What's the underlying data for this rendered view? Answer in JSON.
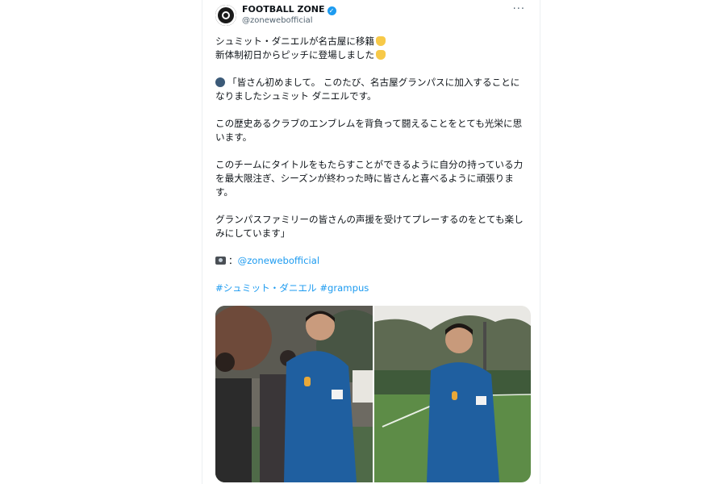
{
  "tweet": {
    "author_name": "FOOTBALL ZONE",
    "author_handle": "@zonewebofficial",
    "more_label": "···",
    "lines": {
      "l1": "シュミット・ダニエルが名古屋に移籍",
      "l2": "新体制初日からピッチに登場しました",
      "l3": "「皆さん初めまして。 このたび、名古屋グランパスに加入することに",
      "l4": "なりましたシュミット ダニエルです。",
      "l5": "この歴史あるクラブのエンブレムを背負って闘えることをとても光栄に思",
      "l6": "います。",
      "l7": "このチームにタイトルをもたらすことができるように自分の持っている力",
      "l8": "を最大限注ぎ、シーズンが終わった時に皆さんと喜べるように頑張りま",
      "l9": "す。",
      "l10": "グランパスファミリーの皆さんの声援を受けてプレーするのをとても楽し",
      "l11": "みにしています」",
      "credit_prefix": "：",
      "credit_handle": "@zonewebofficial",
      "hashtag1": "#シュミット・ダニエル",
      "hashtag2": "#grampus"
    },
    "colors": {
      "link": "#1d9bf0",
      "text": "#0f1419",
      "muted": "#536471",
      "jersey": "#1f5fa0"
    },
    "photos": [
      "player-training-photo-left",
      "player-training-photo-right"
    ]
  }
}
